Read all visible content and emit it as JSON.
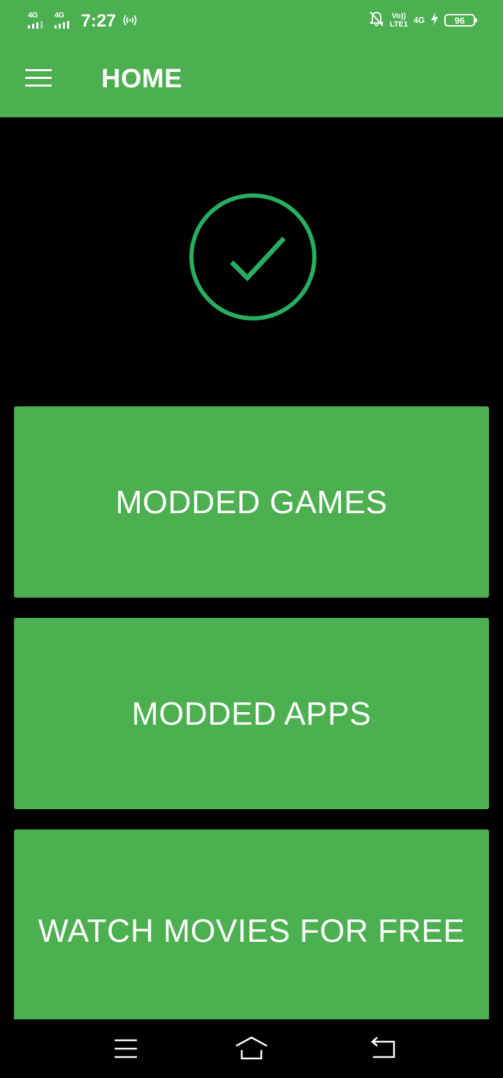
{
  "status_bar": {
    "sim1_network": "4G",
    "sim2_network": "4G",
    "time": "7:27",
    "volte_top": "Vo))",
    "volte_bottom": "LTE1",
    "data_network": "4G",
    "battery_level": "96",
    "icons": [
      "signal-icon",
      "signal-icon",
      "hotspot-icon",
      "bell-muted-icon",
      "volte-icon",
      "data-network-icon",
      "charging-icon",
      "battery-icon"
    ]
  },
  "app_bar": {
    "title": "HOME",
    "menu_icon": "hamburger-menu-icon"
  },
  "emblem": {
    "icon": "check-circle-icon",
    "color": "#27ae60"
  },
  "menu": {
    "items": [
      {
        "label": "MODDED GAMES"
      },
      {
        "label": "MODDED APPS"
      },
      {
        "label": "WATCH MOVIES FOR FREE"
      }
    ]
  },
  "nav_bar": {
    "icons": [
      "recent-apps-icon",
      "home-icon",
      "back-icon"
    ]
  },
  "colors": {
    "primary": "#4caf50",
    "background": "#000000",
    "text": "#ffffff"
  }
}
